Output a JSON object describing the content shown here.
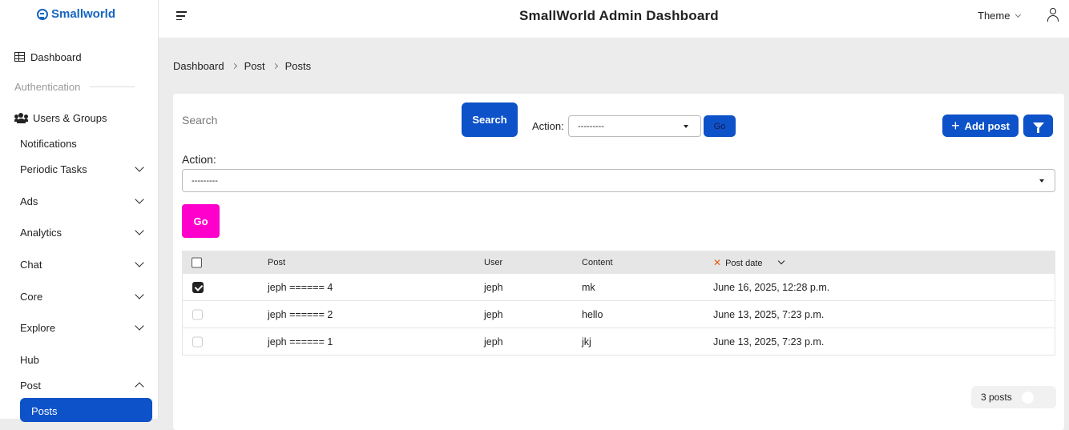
{
  "brand": {
    "name": "Smallworld"
  },
  "header": {
    "title": "SmallWorld Admin Dashboard",
    "theme_label": "Theme"
  },
  "sidebar": {
    "dashboard": "Dashboard",
    "section": "Authentication",
    "users_groups": "Users & Groups",
    "items": [
      "Notifications",
      "Periodic Tasks",
      "Ads",
      "Analytics",
      "Chat",
      "Core",
      "Explore",
      "Hub",
      "Post"
    ],
    "active": "Posts"
  },
  "breadcrumb": [
    "Dashboard",
    "Post",
    "Posts"
  ],
  "toolbar": {
    "search_placeholder": "Search",
    "search_button": "Search",
    "action_label": "Action:",
    "action_value": "---------",
    "go": "Go",
    "add_post": "Add post"
  },
  "bulk": {
    "action_label": "Action:",
    "action_value": "---------",
    "go": "Go"
  },
  "table": {
    "columns": [
      "Post",
      "User",
      "Content",
      "Post date"
    ],
    "rows": [
      {
        "checked": true,
        "post": "jeph ====== 4",
        "user": "jeph",
        "content": "mk",
        "date": "June 16, 2025, 12:28 p.m."
      },
      {
        "checked": false,
        "post": "jeph ====== 2",
        "user": "jeph",
        "content": "hello",
        "date": "June 13, 2025, 7:23 p.m."
      },
      {
        "checked": false,
        "post": "jeph ====== 1",
        "user": "jeph",
        "content": "jkj",
        "date": "June 13, 2025, 7:23 p.m."
      }
    ]
  },
  "pager": {
    "count_label": "3 posts"
  },
  "colors": {
    "primary": "#0d52c8",
    "go_pink": "#ff00cc",
    "sort_x": "#e8590c"
  }
}
